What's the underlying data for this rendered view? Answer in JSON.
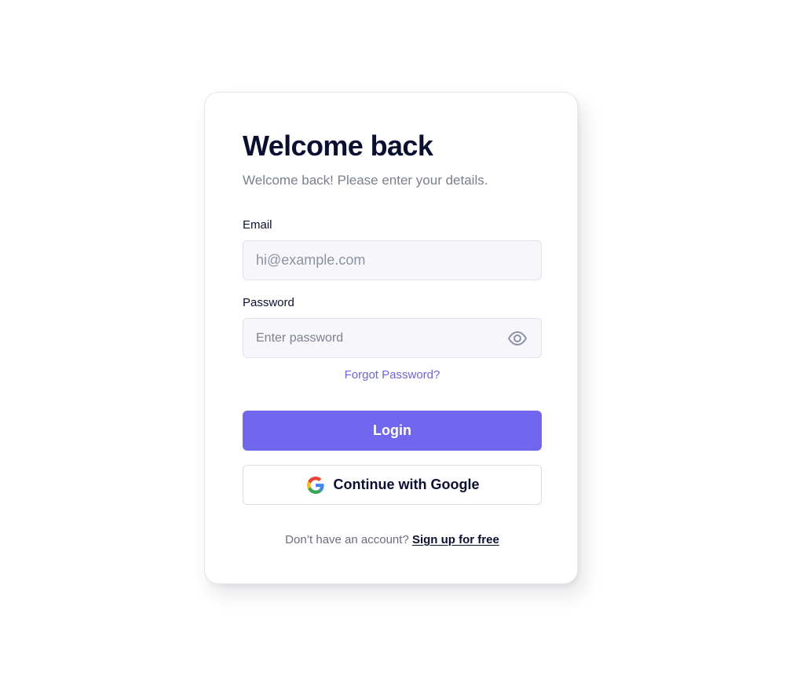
{
  "login_card": {
    "title": "Welcome back",
    "subtitle": "Welcome back! Please enter your details.",
    "email": {
      "label": "Email",
      "placeholder": "hi@example.com",
      "value": ""
    },
    "password": {
      "label": "Password",
      "placeholder": "Enter password",
      "value": "",
      "toggle_icon": "eye-icon"
    },
    "forgot_password_link": "Forgot Password?",
    "login_button": "Login",
    "google_button": {
      "label": "Continue with Google",
      "icon": "google-icon"
    },
    "signup_prompt": "Don’t have an account?",
    "signup_link": "Sign up for free"
  },
  "colors": {
    "accent": "#7067ee",
    "link": "#6e64e4",
    "heading": "#0b1032",
    "muted_text": "#7b7f8e",
    "input_background": "#f6f6fb"
  }
}
